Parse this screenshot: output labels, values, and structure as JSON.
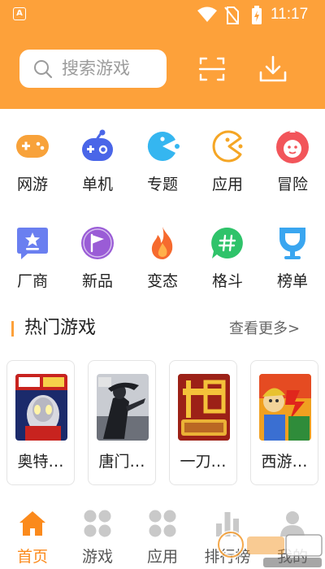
{
  "status_bar": {
    "time": "11:17"
  },
  "search": {
    "placeholder": "搜索游戏"
  },
  "header_actions": {
    "scan_icon": "scan-icon",
    "download_icon": "download-icon"
  },
  "categories": [
    {
      "label": "网游",
      "icon": "gamepad-icon",
      "color": "#f8a23a"
    },
    {
      "label": "单机",
      "icon": "controller-icon",
      "color": "#4a66e8"
    },
    {
      "label": "专题",
      "icon": "pacman-ghost-icon",
      "color": "#35b6f0"
    },
    {
      "label": "应用",
      "icon": "pacman-icon",
      "color": "#f5a625"
    },
    {
      "label": "冒险",
      "icon": "mascot-icon",
      "color": "#f2555a"
    },
    {
      "label": "厂商",
      "icon": "star-badge-icon",
      "color": "#6a7ff0"
    },
    {
      "label": "新品",
      "icon": "flag-icon",
      "color": "#9a5cd6"
    },
    {
      "label": "变态",
      "icon": "flame-icon",
      "color": "#f66a2e"
    },
    {
      "label": "格斗",
      "icon": "hash-chat-icon",
      "color": "#2fc36a"
    },
    {
      "label": "榜单",
      "icon": "trophy-icon",
      "color": "#3aa6f0"
    }
  ],
  "hot_section": {
    "title": "热门游戏",
    "more": "查看更多>"
  },
  "hot_games": [
    {
      "name": "奥特…"
    },
    {
      "name": "唐门…"
    },
    {
      "name": "一刀…"
    },
    {
      "name": "西游…"
    }
  ],
  "tabs": [
    {
      "label": "首页",
      "active": true
    },
    {
      "label": "游戏",
      "active": false
    },
    {
      "label": "应用",
      "active": false
    },
    {
      "label": "排行榜",
      "active": false
    },
    {
      "label": "我的",
      "active": false
    }
  ],
  "colors": {
    "accent": "#fda13a",
    "active_tab": "#fb8a1c"
  }
}
